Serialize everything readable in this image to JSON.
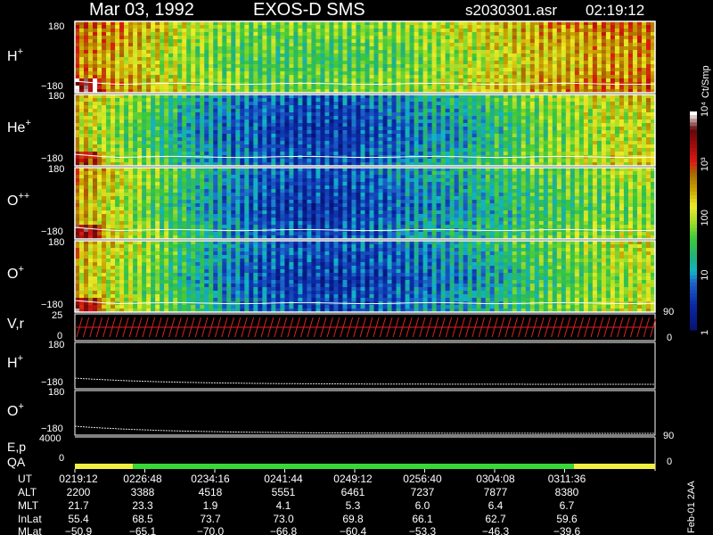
{
  "header": {
    "date": "Mar 03, 1992",
    "instrument": "EXOS-D SMS",
    "file": "s2030301.asr",
    "time": "02:19:12"
  },
  "colorbar": {
    "label": "Ct/Smp",
    "ticks": [
      {
        "value": 1,
        "text": "1"
      },
      {
        "value": 10,
        "text": "10"
      },
      {
        "value": 100,
        "text": "100"
      },
      {
        "value": 1000,
        "text": "10³"
      },
      {
        "value": 10000,
        "text": "10⁴"
      }
    ],
    "scale": "log",
    "range": [
      1,
      10000
    ]
  },
  "side_note": "Feb-01 2AA",
  "chart_data": {
    "type": "heatmap",
    "time_axis": {
      "ticks": [
        "0219:12",
        "0226:48",
        "0234:16",
        "0241:44",
        "0249:12",
        "0256:40",
        "0304:08",
        "0311:36"
      ]
    },
    "panels": [
      {
        "name": "H+",
        "species": "H",
        "charge": "+",
        "y_top": "180",
        "y_bottom": "−180",
        "intensity_profile": [
          2.6,
          2.4,
          2.1,
          1.8,
          1.6,
          1.5,
          1.5,
          1.5,
          1.6,
          1.7,
          1.9,
          2.1,
          2.3,
          2.4,
          2.5,
          2.6
        ]
      },
      {
        "name": "He+",
        "species": "He",
        "charge": "+",
        "y_top": "180",
        "y_bottom": "−180",
        "intensity_profile": [
          2.2,
          1.8,
          1.4,
          1.0,
          0.7,
          0.5,
          0.4,
          0.4,
          0.6,
          0.9,
          1.0,
          1.3,
          1.6,
          1.8,
          2.0,
          2.1
        ]
      },
      {
        "name": "O++",
        "species": "O",
        "charge": "++",
        "y_top": "180",
        "y_bottom": "−180",
        "intensity_profile": [
          2.4,
          2.0,
          1.6,
          1.2,
          0.8,
          0.5,
          0.4,
          0.4,
          0.6,
          0.9,
          1.0,
          1.2,
          1.4,
          1.5,
          1.7,
          1.8
        ]
      },
      {
        "name": "O+",
        "species": "O",
        "charge": "+",
        "y_top": "180",
        "y_bottom": "−180",
        "intensity_profile": [
          2.3,
          2.0,
          1.6,
          1.2,
          0.8,
          0.5,
          0.4,
          0.4,
          0.5,
          0.7,
          0.9,
          1.1,
          1.4,
          1.6,
          1.8,
          2.0
        ]
      }
    ],
    "vr_panel": {
      "label": "V,r",
      "left_ticks": [
        "25",
        "0"
      ],
      "right_ticks": [
        "90",
        "0"
      ]
    },
    "h_panel": {
      "label": "H+",
      "y_top": "180",
      "y_bottom": "−180"
    },
    "o_panel": {
      "label": "O+",
      "y_top": "180",
      "y_bottom": "−180"
    },
    "ep_panel": {
      "label": "E,p",
      "left_ticks": [
        "4000",
        "0"
      ],
      "right_ticks": [
        "90",
        "0"
      ]
    },
    "qa": {
      "label": "QA",
      "segments": [
        {
          "color": "#f0f040",
          "from": 0.0,
          "to": 0.1
        },
        {
          "color": "#38d838",
          "from": 0.1,
          "to": 0.86
        },
        {
          "color": "#f0f040",
          "from": 0.86,
          "to": 1.0
        }
      ]
    },
    "table": {
      "rows": [
        {
          "label": "UT",
          "values": [
            "0219:12",
            "0226:48",
            "0234:16",
            "0241:44",
            "0249:12",
            "0256:40",
            "0304:08",
            "0311:36"
          ]
        },
        {
          "label": "ALT",
          "values": [
            "2200",
            "3388",
            "4518",
            "5551",
            "6461",
            "7237",
            "7877",
            "8380"
          ]
        },
        {
          "label": "MLT",
          "values": [
            "21.7",
            "23.3",
            "1.9",
            "4.1",
            "5.3",
            "6.0",
            "6.4",
            "6.7"
          ]
        },
        {
          "label": "InLat",
          "values": [
            "55.4",
            "68.5",
            "73.7",
            "73.0",
            "69.8",
            "66.1",
            "62.7",
            "59.6"
          ]
        },
        {
          "label": "MLat",
          "values": [
            "−50.9",
            "−65.1",
            "−70.0",
            "−66.8",
            "−60.4",
            "−53.3",
            "−46.3",
            "−39.6"
          ]
        }
      ]
    }
  }
}
